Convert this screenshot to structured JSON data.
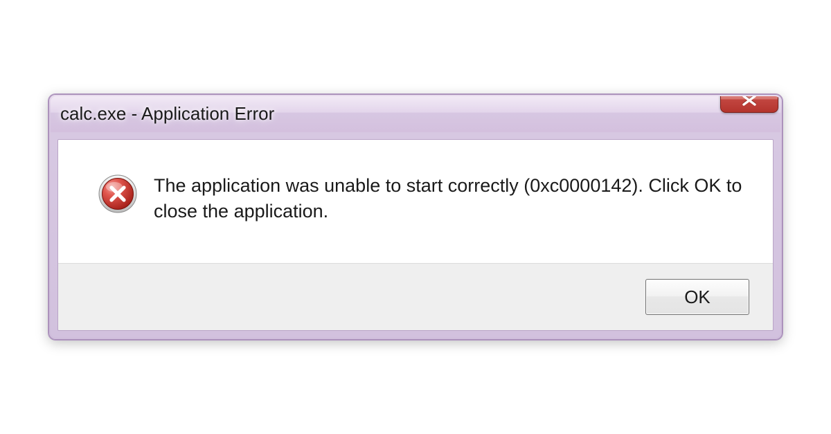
{
  "dialog": {
    "title": "calc.exe - Application Error",
    "message": "The application was unable to start correctly (0xc0000142). Click OK to close the application.",
    "ok_label": "OK"
  }
}
